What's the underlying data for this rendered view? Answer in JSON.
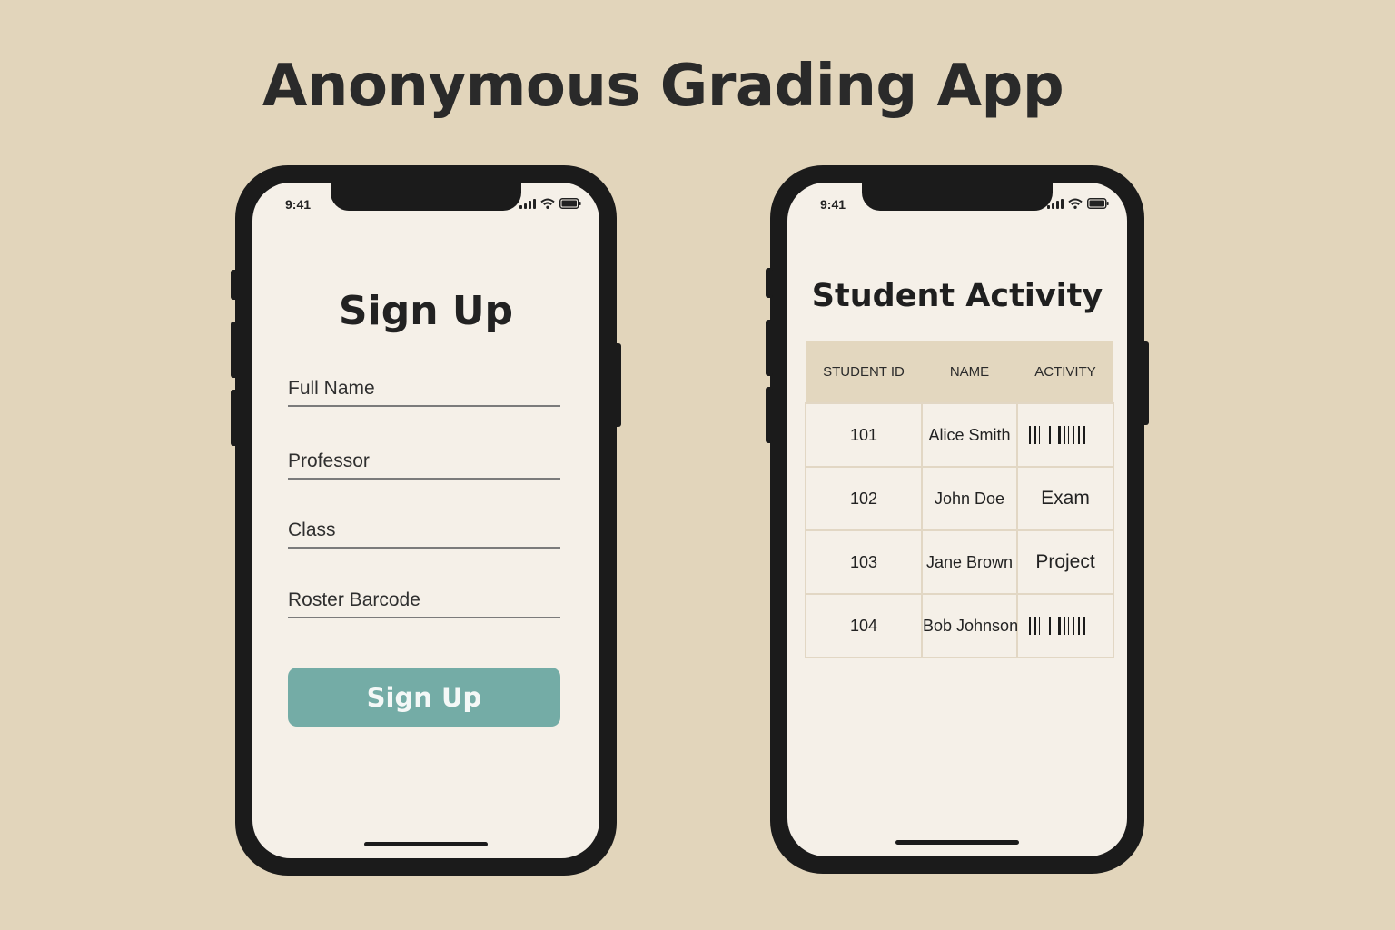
{
  "app_title": "Anonymous Grading App",
  "status_bar": {
    "time": "9:41"
  },
  "signup_screen": {
    "title": "Sign Up",
    "fields": [
      {
        "placeholder": "Full Name",
        "value": ""
      },
      {
        "placeholder": "Professor",
        "value": ""
      },
      {
        "placeholder": "Class",
        "value": ""
      },
      {
        "placeholder": "Roster Barcode",
        "value": ""
      }
    ],
    "submit_label": "Sign Up",
    "button_color": "#74aca6"
  },
  "activity_screen": {
    "title": "Student Activity",
    "columns": [
      "STUDENT ID",
      "NAME",
      "ACTIVITY"
    ],
    "rows": [
      {
        "id": "101",
        "name": "Alice Smith",
        "activity": "",
        "activity_icon": "barcode-icon"
      },
      {
        "id": "102",
        "name": "John Doe",
        "activity": "Exam"
      },
      {
        "id": "103",
        "name": "Jane Brown",
        "activity": "Project"
      },
      {
        "id": "104",
        "name": "Bob Johnson",
        "activity": "",
        "activity_icon": "barcode-icon"
      }
    ]
  },
  "icons": [
    "signal-icon",
    "wifi-icon",
    "battery-icon",
    "barcode-icon"
  ],
  "colors": {
    "background": "#e2d5bb",
    "screen": "#f5f0e8",
    "header_row": "#e3d7bf",
    "frame": "#1b1b1b"
  }
}
